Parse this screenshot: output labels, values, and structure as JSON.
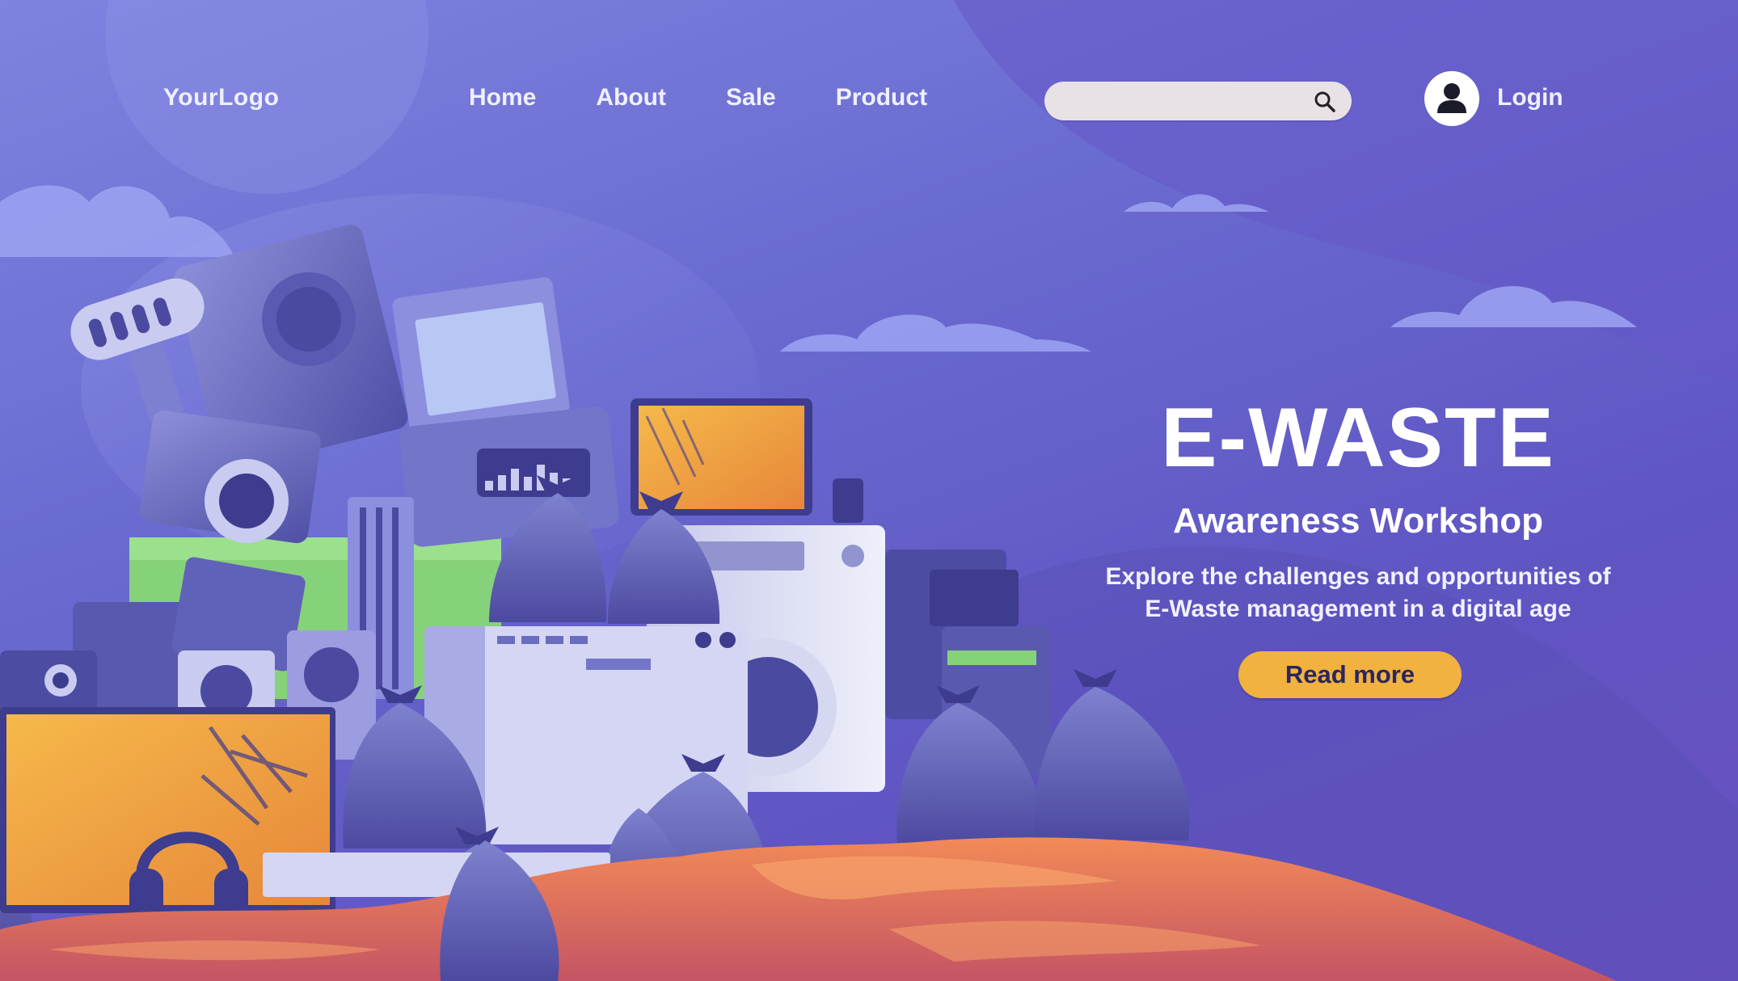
{
  "header": {
    "logo": "YourLogo",
    "nav": [
      "Home",
      "About",
      "Sale",
      "Product"
    ],
    "search": {
      "value": "",
      "placeholder": ""
    },
    "login_label": "Login"
  },
  "hero": {
    "title": "E-WASTE",
    "subtitle": "Awareness Workshop",
    "description_line1": "Explore the challenges and opportunities of",
    "description_line2": "E-Waste management in a digital age",
    "cta_label": "Read more"
  },
  "icons": {
    "search": "search-icon",
    "user": "user-avatar-icon"
  },
  "colors": {
    "background_primary": "#6a6bd1",
    "background_dark": "#5f55c3",
    "cta": "#f1b23f",
    "ground": "#e8704e",
    "screen": "#f2a93c",
    "bin": "#86d27a",
    "text": "#ffffff"
  }
}
